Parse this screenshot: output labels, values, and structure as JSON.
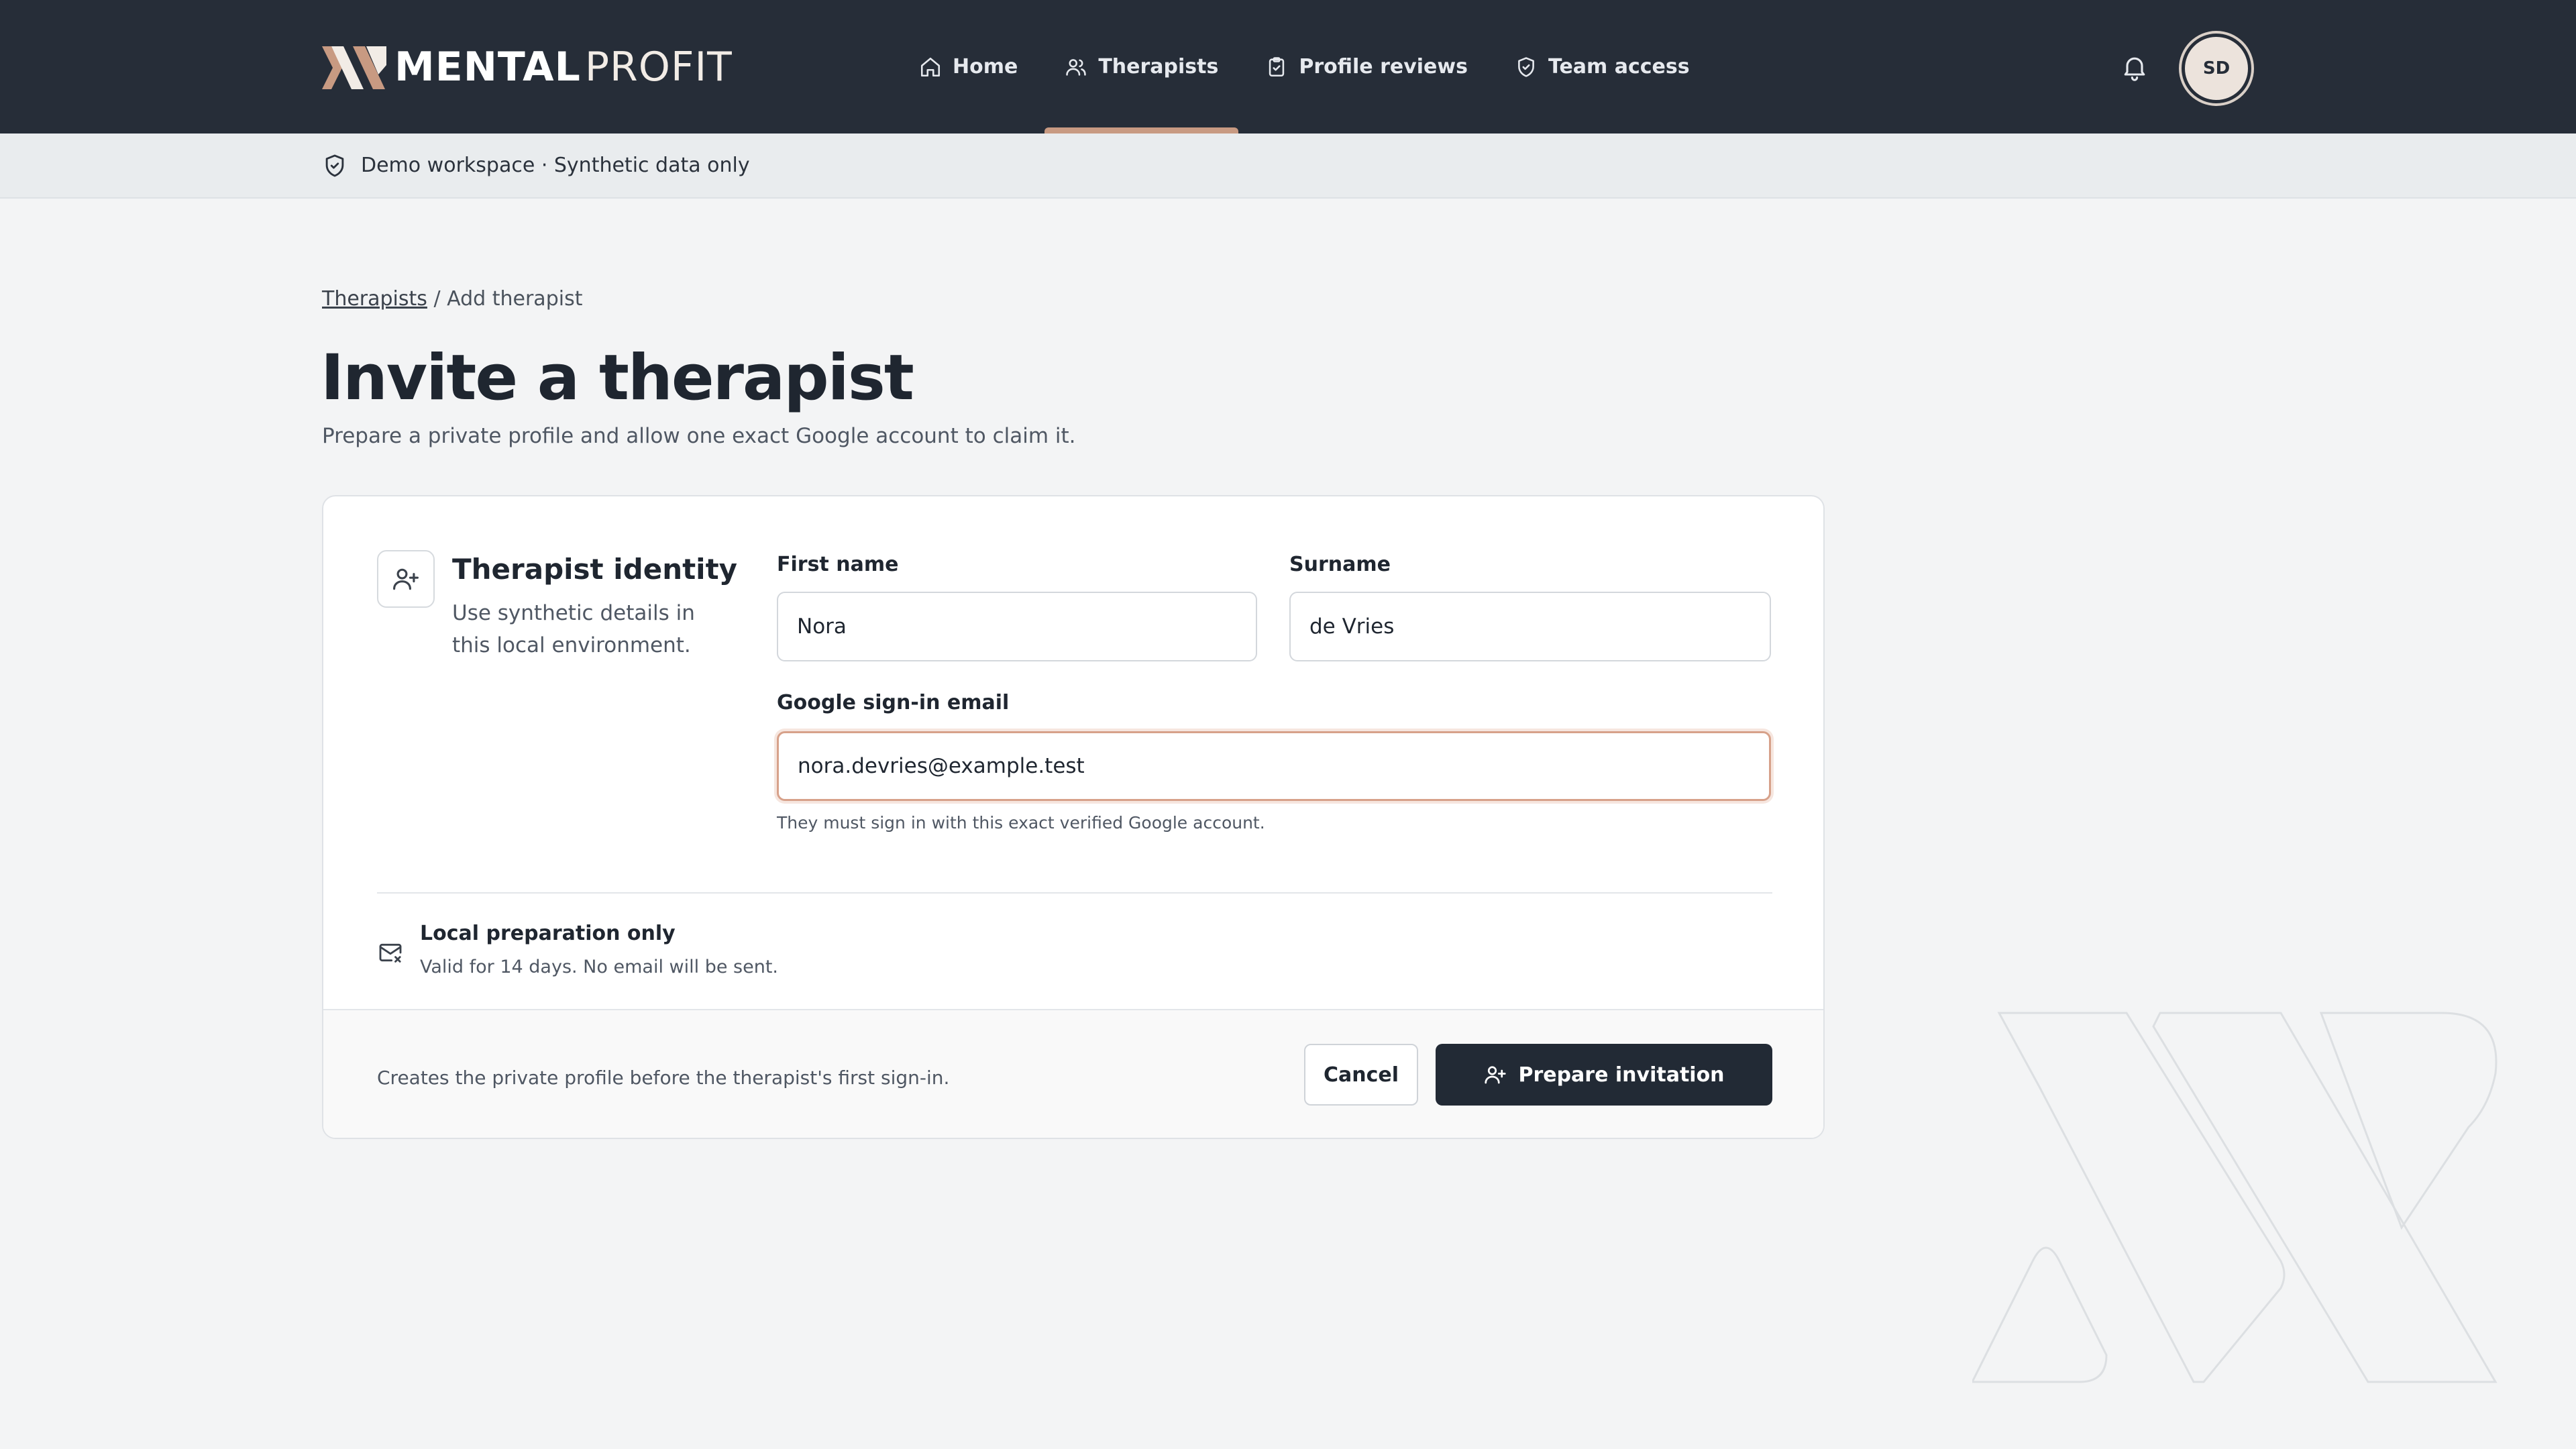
{
  "brand": {
    "part1": "MENTAL",
    "part2": "PROFIT"
  },
  "nav": {
    "items": [
      {
        "label": "Home",
        "icon": "home-icon"
      },
      {
        "label": "Therapists",
        "icon": "users-icon",
        "active": true
      },
      {
        "label": "Profile reviews",
        "icon": "clipboard-check-icon"
      },
      {
        "label": "Team access",
        "icon": "shield-check-icon"
      }
    ],
    "avatar_initials": "SD"
  },
  "demo_strip": {
    "text": "Demo workspace · Synthetic data only"
  },
  "breadcrumb": {
    "parent": "Therapists",
    "separator": "/",
    "current": "Add therapist"
  },
  "page": {
    "title": "Invite a therapist",
    "subtitle": "Prepare a private profile and allow one exact Google account to claim it."
  },
  "identity": {
    "title": "Therapist identity",
    "description": "Use synthetic details in this local environment."
  },
  "form": {
    "first_name": {
      "label": "First name",
      "value": "Nora"
    },
    "surname": {
      "label": "Surname",
      "value": "de Vries"
    },
    "email": {
      "label": "Google sign-in email",
      "value": "nora.devries@example.test",
      "hint": "They must sign in with this exact verified Google account."
    }
  },
  "local_prep": {
    "title": "Local preparation only",
    "description": "Valid for 14 days. No email will be sent."
  },
  "footer": {
    "text": "Creates the private profile before the therapist's first sign-in.",
    "cancel_label": "Cancel",
    "submit_label": "Prepare invitation"
  },
  "colors": {
    "nav_bg": "#262d38",
    "accent": "#c89a82",
    "primary_button": "#222a35",
    "focus_border": "#d7a18a"
  }
}
